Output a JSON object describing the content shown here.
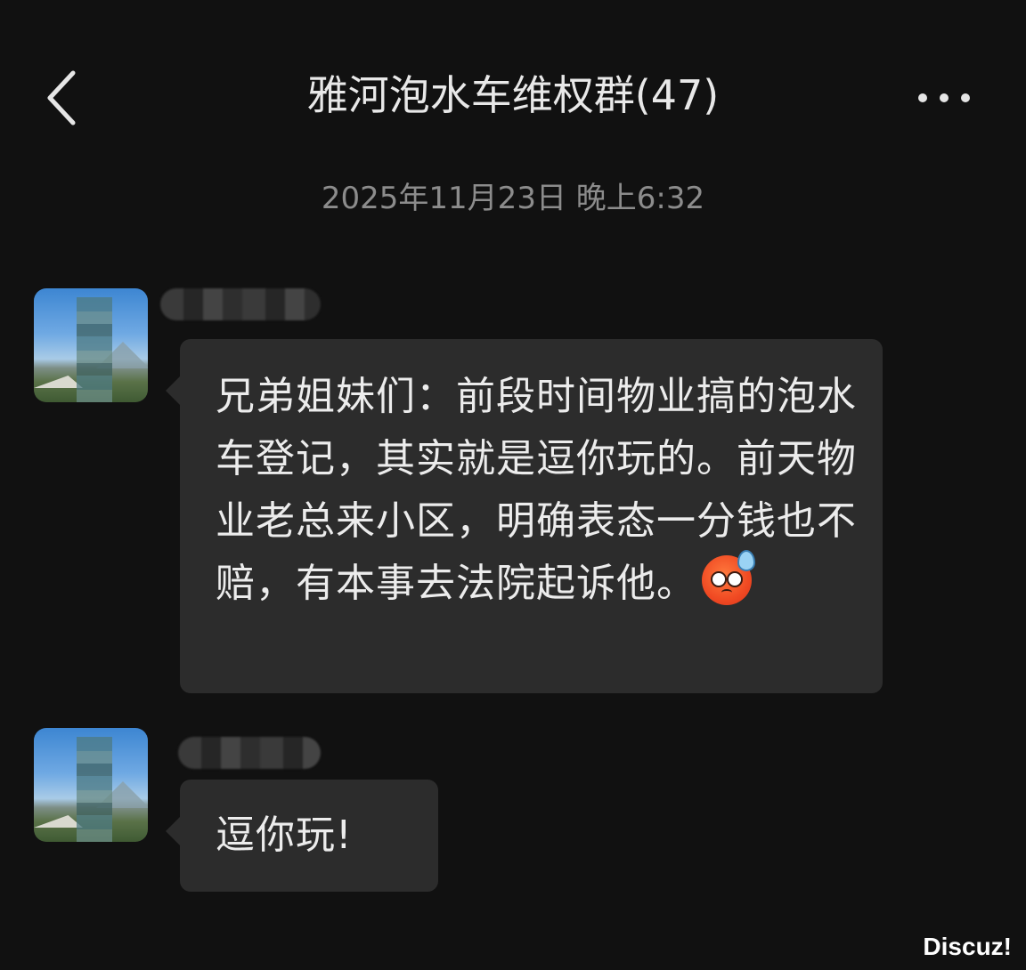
{
  "header": {
    "title": "雅河泡水车维权群(47)",
    "back_icon": "chevron-left-icon",
    "more_icon": "more-dots-icon"
  },
  "timestamp": "2025年11月23日 晚上6:32",
  "messages": [
    {
      "text": "兄弟姐妹们：前段时间物业搞的泡水车登记，其实就是逗你玩的。前天物业老总来小区，明确表态一分钱也不赔，有本事去法院起诉他。",
      "emoji": "anxious-sweat-face-icon"
    },
    {
      "text": "逗你玩!"
    }
  ],
  "watermark": "Discuz!",
  "colors": {
    "background": "#111111",
    "bubble": "#2c2c2c",
    "text": "#ececec",
    "timestamp": "#8c8c8c"
  }
}
